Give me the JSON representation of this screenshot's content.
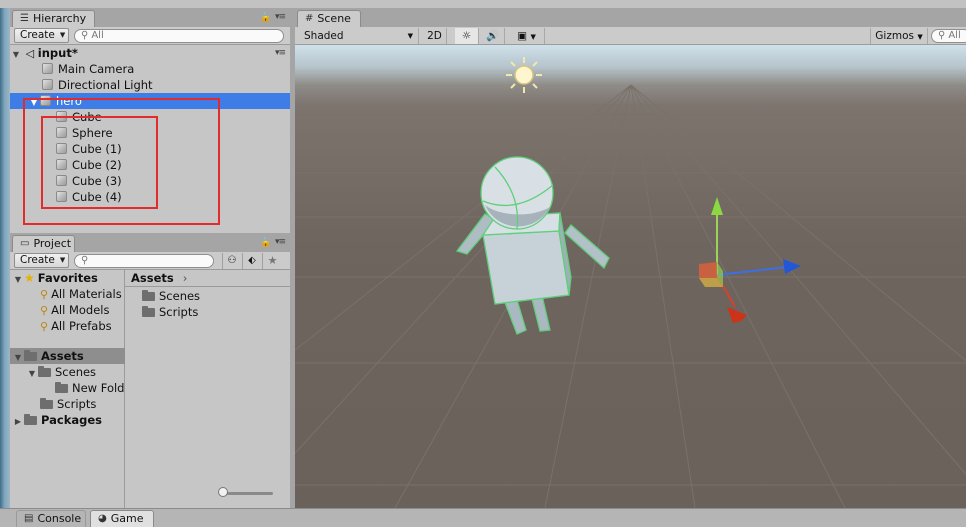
{
  "hierarchy": {
    "tab_label": "Hierarchy",
    "create_label": "Create",
    "search_placeholder": "All",
    "scene_name": "input*",
    "items": [
      {
        "label": "Main Camera"
      },
      {
        "label": "Directional Light"
      },
      {
        "label": "hero"
      },
      {
        "label": "Cube"
      },
      {
        "label": "Sphere"
      },
      {
        "label": "Cube (1)"
      },
      {
        "label": "Cube (2)"
      },
      {
        "label": "Cube (3)"
      },
      {
        "label": "Cube (4)"
      }
    ]
  },
  "project": {
    "tab_label": "Project",
    "create_label": "Create",
    "tree": {
      "favorites": "Favorites",
      "all_materials": "All Materials",
      "all_models": "All Models",
      "all_prefabs": "All Prefabs",
      "assets": "Assets",
      "scenes": "Scenes",
      "new_folder": "New Fold",
      "scripts": "Scripts",
      "packages": "Packages"
    },
    "breadcrumb": "Assets",
    "contents": [
      {
        "label": "Scenes"
      },
      {
        "label": "Scripts"
      }
    ]
  },
  "scene": {
    "tab_label": "Scene",
    "shading_mode": "Shaded",
    "mode_2d": "2D",
    "gizmos_label": "Gizmos",
    "search_placeholder": "All"
  },
  "bottom_tabs": {
    "console": "Console",
    "game": "Game"
  },
  "colors": {
    "selection": "#3e7ce8",
    "highlight_box": "#e22c2c"
  }
}
